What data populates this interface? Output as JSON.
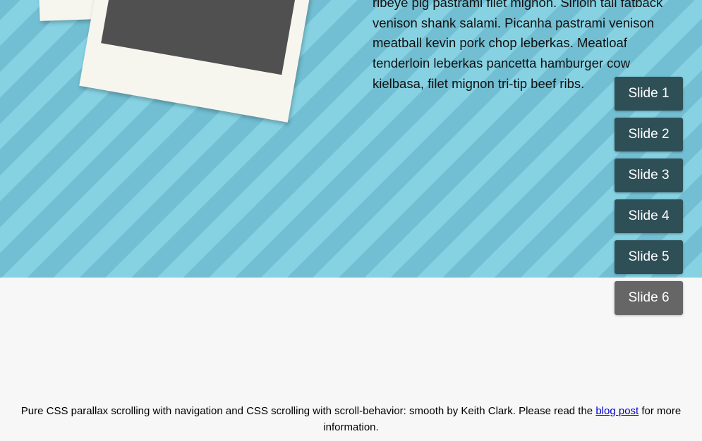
{
  "slide": {
    "body_text": "ribeye pig pastrami filet mignon. Sirloin tail fatback venison shank salami. Picanha pastrami venison meatball kevin pork chop leberkas. Meatloaf tenderloin leberkas pancetta hamburger cow kielbasa, filet mignon tri-tip beef ribs."
  },
  "nav": {
    "items": [
      {
        "label": "Slide 1"
      },
      {
        "label": "Slide 2"
      },
      {
        "label": "Slide 3"
      },
      {
        "label": "Slide 4"
      },
      {
        "label": "Slide 5"
      },
      {
        "label": "Slide 6"
      }
    ]
  },
  "footer": {
    "text_before": "Pure CSS parallax scrolling with navigation and CSS scrolling with scroll-behavior: smooth by Keith Clark. Please read the ",
    "link_label": "blog post",
    "text_after": " for more information."
  },
  "colors": {
    "stripe_light": "#86d2e3",
    "stripe_dark": "#72bed2",
    "nav_button": "#2f4f57",
    "nav_button_inactive": "#666666",
    "page_background": "#f7f7f7",
    "link": "#0000cc"
  }
}
